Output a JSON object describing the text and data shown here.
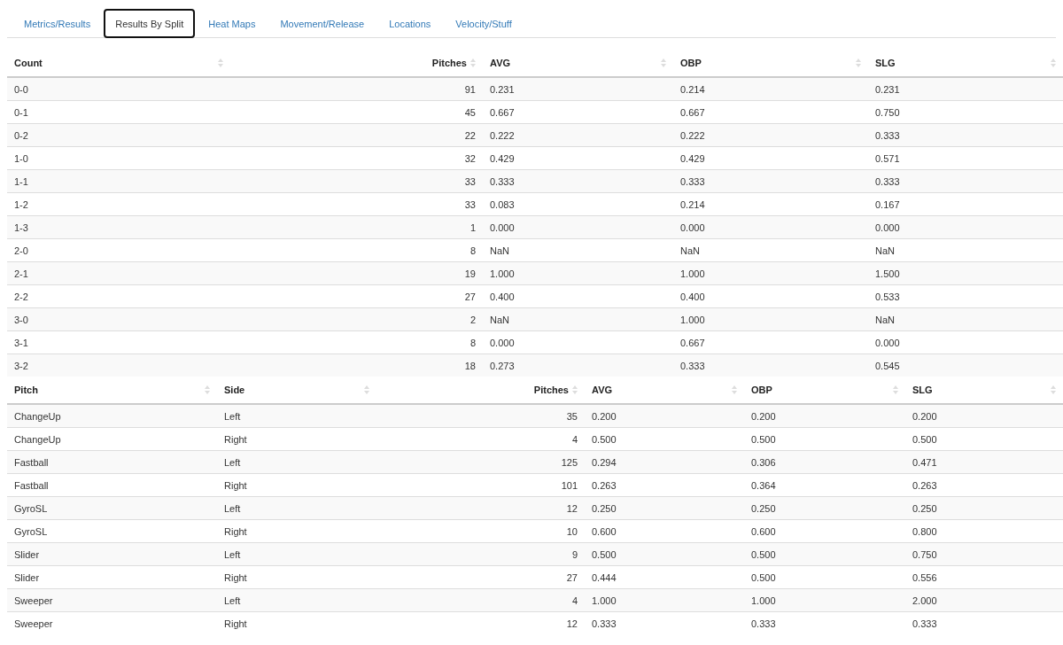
{
  "tabs": [
    {
      "label": "Metrics/Results",
      "selected": false
    },
    {
      "label": "Results By Split",
      "selected": true
    },
    {
      "label": "Heat Maps",
      "selected": false
    },
    {
      "label": "Movement/Release",
      "selected": false
    },
    {
      "label": "Locations",
      "selected": false
    },
    {
      "label": "Velocity/Stuff",
      "selected": false
    }
  ],
  "tables": [
    {
      "columns": [
        {
          "label": "Count",
          "kind": "text"
        },
        {
          "label": "Pitches",
          "kind": "number"
        },
        {
          "label": "AVG",
          "kind": "text"
        },
        {
          "label": "OBP",
          "kind": "text"
        },
        {
          "label": "SLG",
          "kind": "text"
        }
      ],
      "rows": [
        [
          "0-0",
          "91",
          "0.231",
          "0.214",
          "0.231"
        ],
        [
          "0-1",
          "45",
          "0.667",
          "0.667",
          "0.750"
        ],
        [
          "0-2",
          "22",
          "0.222",
          "0.222",
          "0.333"
        ],
        [
          "1-0",
          "32",
          "0.429",
          "0.429",
          "0.571"
        ],
        [
          "1-1",
          "33",
          "0.333",
          "0.333",
          "0.333"
        ],
        [
          "1-2",
          "33",
          "0.083",
          "0.214",
          "0.167"
        ],
        [
          "1-3",
          "1",
          "0.000",
          "0.000",
          "0.000"
        ],
        [
          "2-0",
          "8",
          "NaN",
          "NaN",
          "NaN"
        ],
        [
          "2-1",
          "19",
          "1.000",
          "1.000",
          "1.500"
        ],
        [
          "2-2",
          "27",
          "0.400",
          "0.400",
          "0.533"
        ],
        [
          "3-0",
          "2",
          "NaN",
          "1.000",
          "NaN"
        ],
        [
          "3-1",
          "8",
          "0.000",
          "0.667",
          "0.000"
        ],
        [
          "3-2",
          "18",
          "0.273",
          "0.333",
          "0.545"
        ]
      ]
    },
    {
      "columns": [
        {
          "label": "Pitch",
          "kind": "text"
        },
        {
          "label": "Side",
          "kind": "text"
        },
        {
          "label": "Pitches",
          "kind": "number"
        },
        {
          "label": "AVG",
          "kind": "text"
        },
        {
          "label": "OBP",
          "kind": "text"
        },
        {
          "label": "SLG",
          "kind": "text"
        }
      ],
      "rows": [
        [
          "ChangeUp",
          "Left",
          "35",
          "0.200",
          "0.200",
          "0.200"
        ],
        [
          "ChangeUp",
          "Right",
          "4",
          "0.500",
          "0.500",
          "0.500"
        ],
        [
          "Fastball",
          "Left",
          "125",
          "0.294",
          "0.306",
          "0.471"
        ],
        [
          "Fastball",
          "Right",
          "101",
          "0.263",
          "0.364",
          "0.263"
        ],
        [
          "GyroSL",
          "Left",
          "12",
          "0.250",
          "0.250",
          "0.250"
        ],
        [
          "GyroSL",
          "Right",
          "10",
          "0.600",
          "0.600",
          "0.800"
        ],
        [
          "Slider",
          "Left",
          "9",
          "0.500",
          "0.500",
          "0.750"
        ],
        [
          "Slider",
          "Right",
          "27",
          "0.444",
          "0.500",
          "0.556"
        ],
        [
          "Sweeper",
          "Left",
          "4",
          "1.000",
          "1.000",
          "2.000"
        ],
        [
          "Sweeper",
          "Right",
          "12",
          "0.333",
          "0.333",
          "0.333"
        ]
      ]
    }
  ]
}
